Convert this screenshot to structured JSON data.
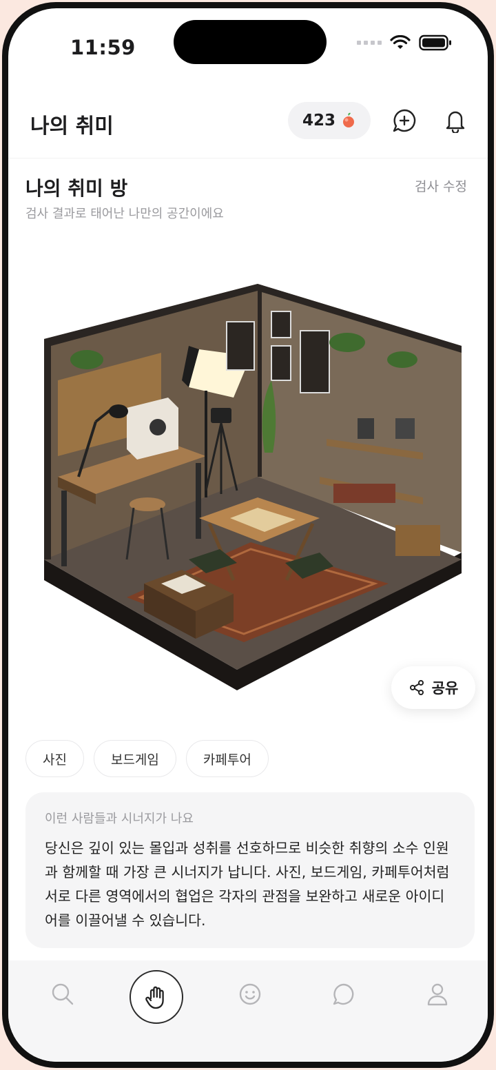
{
  "status_bar": {
    "time": "11:59"
  },
  "header": {
    "title": "나의 취미",
    "points": "423",
    "points_icon": "peach-icon",
    "add_chat_icon": "chat-plus-icon",
    "bell_icon": "bell-icon"
  },
  "section": {
    "title": "나의 취미 방",
    "subtitle": "검사 결과로 태어난 나만의 공간이에요",
    "edit_label": "검사 수정"
  },
  "share": {
    "label": "공유",
    "icon": "share-icon"
  },
  "tags": [
    "사진",
    "보드게임",
    "카페투어"
  ],
  "synergy": {
    "label": "이런 사람들과 시너지가 나요",
    "body": "당신은 깊이 있는 몰입과 성취를 선호하므로 비슷한 취향의 소수 인원과 함께할 때 가장 큰 시너지가 납니다. 사진, 보드게임, 카페투어처럼 서로 다른 영역에서의 협업은 각자의 관점을 보완하고 새로운 아이디어를 이끌어낼 수 있습니다."
  },
  "tabbar": {
    "items": [
      "search-icon",
      "hand-icon",
      "smile-icon",
      "chat-icon",
      "profile-icon"
    ],
    "active": "hand-icon"
  },
  "colors": {
    "accent": "#e8563a",
    "text": "#1d1d1f",
    "muted": "#9a9a9e",
    "card": "#f5f5f6"
  }
}
